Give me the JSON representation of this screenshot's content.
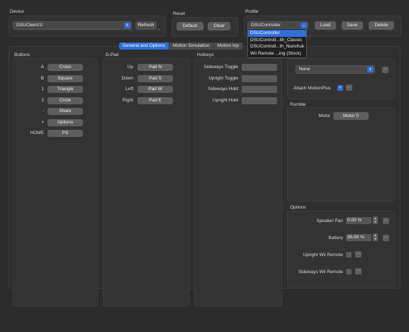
{
  "device": {
    "title": "Device",
    "selected": "DSUClient/1/",
    "refresh_label": "Refresh"
  },
  "reset": {
    "title": "Reset",
    "default_label": "Default",
    "clear_label": "Clear"
  },
  "profile": {
    "title": "Profile",
    "selected": "DSUController",
    "load_label": "Load",
    "save_label": "Save",
    "delete_label": "Delete",
    "options": [
      "DSUController",
      "DSUControll...ith_Classic",
      "DSUControll...th_Nunchuk",
      "Wii Remote ...ing (Stock)"
    ]
  },
  "tabs": [
    "General and Options",
    "Motion Simulation",
    "Motion Inp"
  ],
  "buttons": {
    "title": "Buttons",
    "rows": [
      {
        "label": "A",
        "value": "Cross"
      },
      {
        "label": "B",
        "value": "Square"
      },
      {
        "label": "1",
        "value": "Triangle"
      },
      {
        "label": "2",
        "value": "Circle"
      },
      {
        "label": "-",
        "value": "Share"
      },
      {
        "label": "+",
        "value": "Options"
      },
      {
        "label": "HOME",
        "value": "PS"
      }
    ]
  },
  "dpad": {
    "title": "D-Pad",
    "rows": [
      {
        "label": "Up",
        "value": "Pad N"
      },
      {
        "label": "Down",
        "value": "Pad S"
      },
      {
        "label": "Left",
        "value": "Pad W"
      },
      {
        "label": "Right",
        "value": "Pad E"
      }
    ]
  },
  "hotkeys": {
    "title": "Hotkeys",
    "rows": [
      {
        "label": "Sideways Toggle"
      },
      {
        "label": "Upright Toggle"
      },
      {
        "label": "Sideways Hold"
      },
      {
        "label": "Upright Hold"
      }
    ]
  },
  "extension": {
    "selected": "None",
    "attach_label": "Attach MotionPlus",
    "attach_checked": true
  },
  "rumble": {
    "title": "Rumble",
    "motor_label": "Motor",
    "motor_value": "Motor 0"
  },
  "options": {
    "title": "Options",
    "speaker_label": "Speaker Pan",
    "speaker_value": "0.00 %",
    "battery_label": "Battery",
    "battery_value": "95.00 %",
    "upright_label": "Upright Wii Remote",
    "sideways_label": "Sideways Wii Remote"
  },
  "icons": {
    "chevron": "chevron-updown-icon",
    "more": "ellipsis-icon",
    "check": "checkmark-icon"
  },
  "colors": {
    "accent": "#2f6fd8",
    "background": "#2c2c2c"
  }
}
